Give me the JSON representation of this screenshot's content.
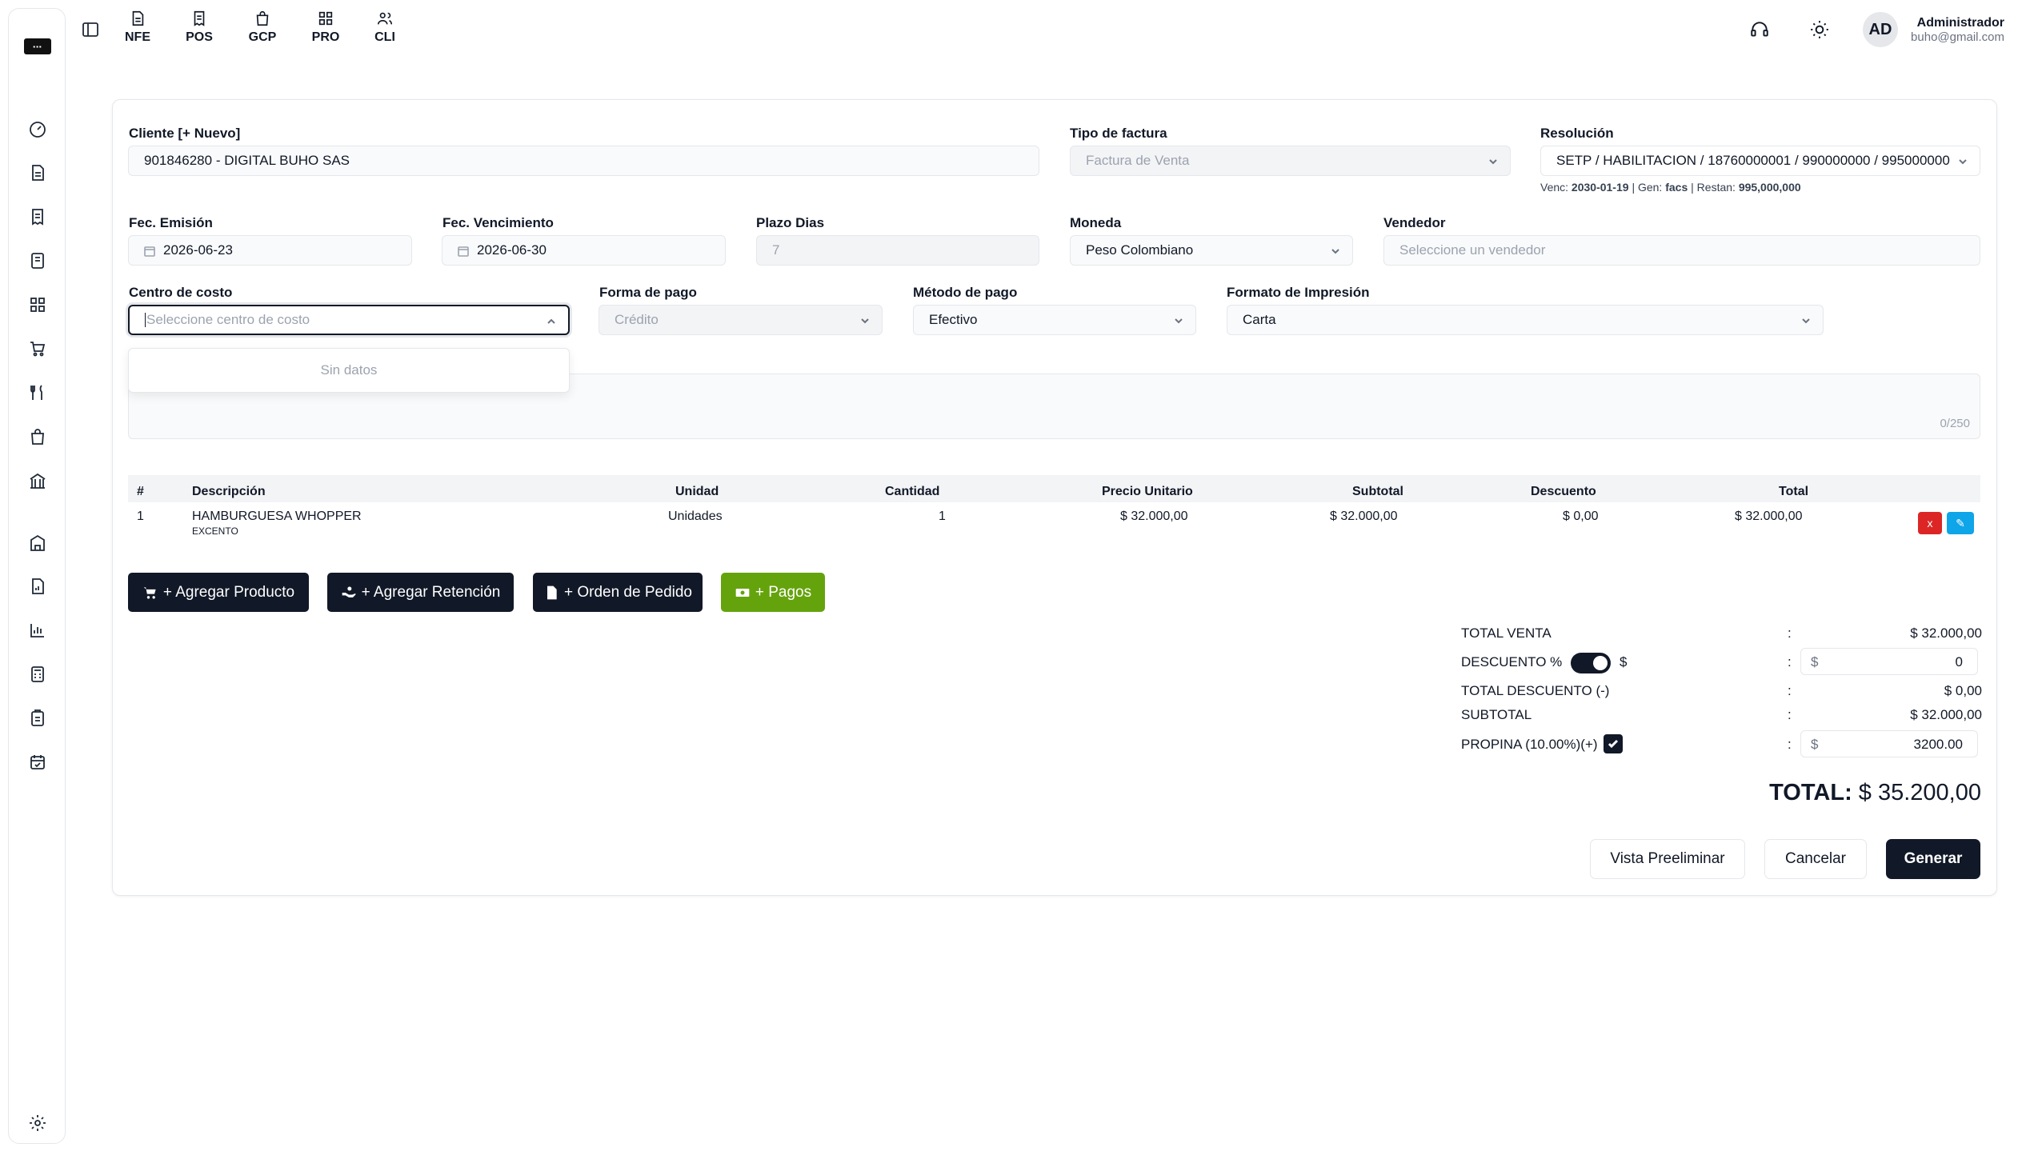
{
  "nav_modules": [
    {
      "label": "NFE",
      "icon": "file-text-icon"
    },
    {
      "label": "POS",
      "icon": "receipt-icon"
    },
    {
      "label": "GCP",
      "icon": "shopping-bag-icon"
    },
    {
      "label": "PRO",
      "icon": "grid-icon"
    },
    {
      "label": "CLI",
      "icon": "users-icon"
    }
  ],
  "user": {
    "initials": "AD",
    "name": "Administrador",
    "email": "buho@gmail.com"
  },
  "form": {
    "cliente": {
      "label": "Cliente [+ Nuevo]",
      "value": "901846280 - DIGITAL BUHO SAS"
    },
    "tipo_factura": {
      "label": "Tipo de factura",
      "value": "Factura de Venta"
    },
    "resolucion": {
      "label": "Resolución",
      "value": "SETP / HABILITACION / 18760000001 / 990000000 / 995000000",
      "venc_label": "Venc:",
      "venc_value": "2030-01-19",
      "gen_label": "| Gen:",
      "gen_value": "facs",
      "restan_label": "| Restan:",
      "restan_value": "995,000,000"
    },
    "fec_emision": {
      "label": "Fec. Emisión",
      "value": "2026-06-23"
    },
    "fec_vencimiento": {
      "label": "Fec. Vencimiento",
      "value": "2026-06-30"
    },
    "plazo_dias": {
      "label": "Plazo Dias",
      "value": "7"
    },
    "moneda": {
      "label": "Moneda",
      "value": "Peso Colombiano"
    },
    "vendedor": {
      "label": "Vendedor",
      "placeholder": "Seleccione un vendedor"
    },
    "centro_costo": {
      "label": "Centro de costo",
      "placeholder": "Seleccione centro de costo",
      "dropdown_empty": "Sin datos"
    },
    "forma_pago": {
      "label": "Forma de pago",
      "value": "Crédito"
    },
    "metodo_pago": {
      "label": "Método de pago",
      "value": "Efectivo"
    },
    "formato_impresion": {
      "label": "Formato de Impresión",
      "value": "Carta"
    },
    "notas_counter": "0/250"
  },
  "table": {
    "headers": {
      "num": "#",
      "descripcion": "Descripción",
      "unidad": "Unidad",
      "cantidad": "Cantidad",
      "precio": "Precio Unitario",
      "subtotal": "Subtotal",
      "descuento": "Descuento",
      "total": "Total"
    },
    "rows": [
      {
        "num": "1",
        "descripcion": "HAMBURGUESA WHOPPER",
        "tax": "EXCENTO",
        "unidad": "Unidades",
        "cantidad": "1",
        "precio": "$ 32.000,00",
        "subtotal": "$ 32.000,00",
        "descuento": "$ 0,00",
        "total": "$ 32.000,00",
        "delete_label": "x",
        "edit_label": "✎"
      }
    ]
  },
  "actions": {
    "agregar_producto": "+ Agregar Producto",
    "agregar_retencion": "+ Agregar Retención",
    "orden_pedido": "+ Orden de Pedido",
    "pagos": "+ Pagos"
  },
  "totals": {
    "total_venta_label": "TOTAL VENTA",
    "total_venta": "$ 32.000,00",
    "descuento_label": "DESCUENTO %",
    "descuento_dollar": "$",
    "descuento_currency": "$",
    "descuento_value": "0",
    "total_descuento_label": "TOTAL DESCUENTO (-)",
    "total_descuento": "$ 0,00",
    "subtotal_label": "SUBTOTAL",
    "subtotal": "$ 32.000,00",
    "propina_label": "PROPINA (10.00%)(+)",
    "propina_currency": "$",
    "propina_value": "3200.00",
    "colon": ":",
    "grand_label": "TOTAL:",
    "grand_value": "$ 35.200,00"
  },
  "footer": {
    "vista_preliminar": "Vista Preeliminar",
    "cancelar": "Cancelar",
    "generar": "Generar"
  },
  "colors": {
    "primary": "#111827",
    "success": "#65a30d",
    "danger": "#dc2626",
    "info": "#0ea5e9"
  }
}
